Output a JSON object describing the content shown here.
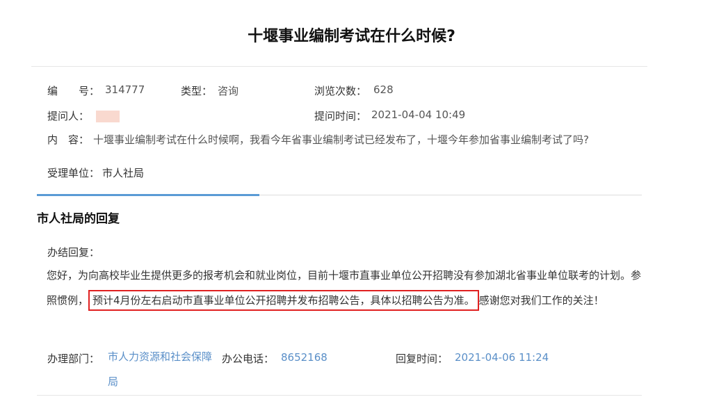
{
  "page": {
    "title": "十堰事业编制考试在什么时候?"
  },
  "info": {
    "number_label": "编　　号：",
    "number_value": "314777",
    "type_label": "类型：",
    "type_value": "咨询",
    "views_label": "浏览次数：",
    "views_value": "628",
    "asker_label": "提问人：",
    "asktime_label": "提问时间：",
    "asktime_value": "2021-04-04 10:49",
    "content_label": "内　容：",
    "content_value": "十堰事业编制考试在什么时候啊，我看今年省事业编制考试已经发布了，十堰今年参加省事业编制考试了吗?",
    "dept_label": "受理单位：",
    "dept_value": "市人社局"
  },
  "reply": {
    "section_title": "市人社局的回复",
    "header": "办结回复：",
    "text_part1": "您好，为向高校毕业生提供更多的报考机会和就业岗位，目前十堰市直事业单位公开招聘没有参加湖北省事业单位联考的计划。参照惯例，",
    "text_highlight": "预计4月份左右启动市直事业单位公开招聘并发布招聘公告，具体以招聘公告为准。",
    "text_part2": "感谢您对我们工作的关注！",
    "handling_dept_label": "办理部门：",
    "handling_dept_value": "市人力资源和社会保障局",
    "phone_label": "办公电话：",
    "phone_value": "8652168",
    "reply_time_label": "回复时间：",
    "reply_time_value": "2021-04-06 11:24"
  },
  "colors": {
    "accent": "#5a9bd5",
    "highlight_border": "#e02020",
    "link_text": "#5a8fc8"
  }
}
